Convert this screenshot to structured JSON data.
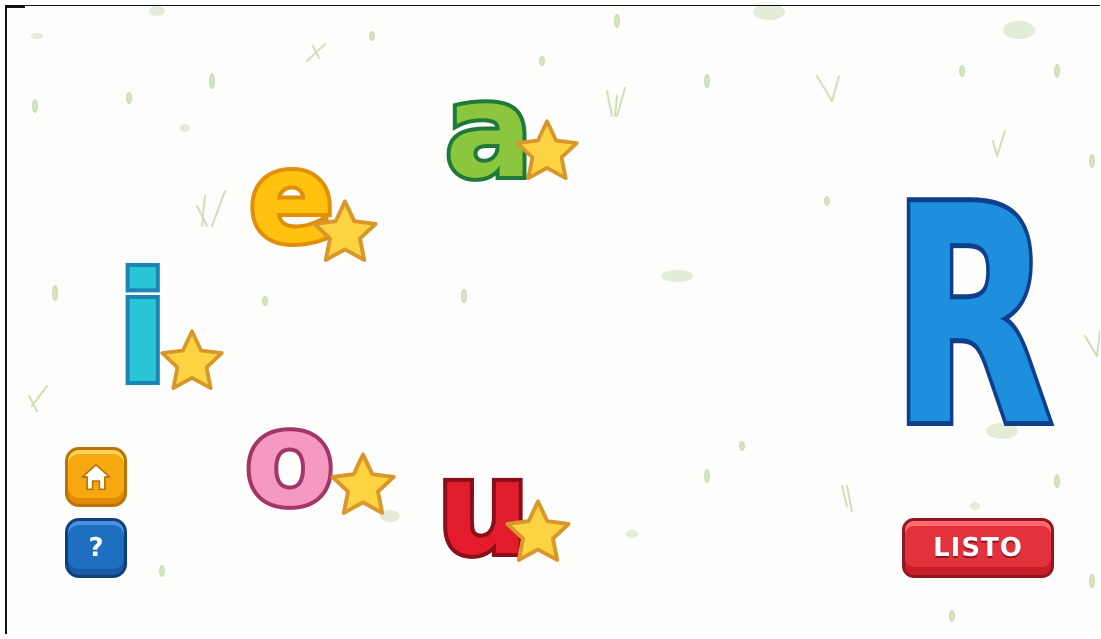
{
  "game": {
    "target_letter": "R",
    "vowels": [
      {
        "id": "a",
        "char": "a",
        "color": "#8cc63f"
      },
      {
        "id": "e",
        "char": "e",
        "color": "#ffc20e"
      },
      {
        "id": "i",
        "char": "i",
        "color": "#29c4d8"
      },
      {
        "id": "o",
        "char": "o",
        "color": "#f49ac1"
      },
      {
        "id": "u",
        "char": "u",
        "color": "#e21b2d"
      }
    ],
    "done_label": "LISTO",
    "help_symbol": "?"
  },
  "icons": {
    "home": "home-icon",
    "help": "question-icon",
    "star": "star-icon"
  },
  "colors": {
    "background": "#fdfdfb",
    "accent_orange": "#f7a70f",
    "accent_blue": "#1f6fc0",
    "accent_red": "#e2323d",
    "target_blue": "#1e8fdc"
  }
}
